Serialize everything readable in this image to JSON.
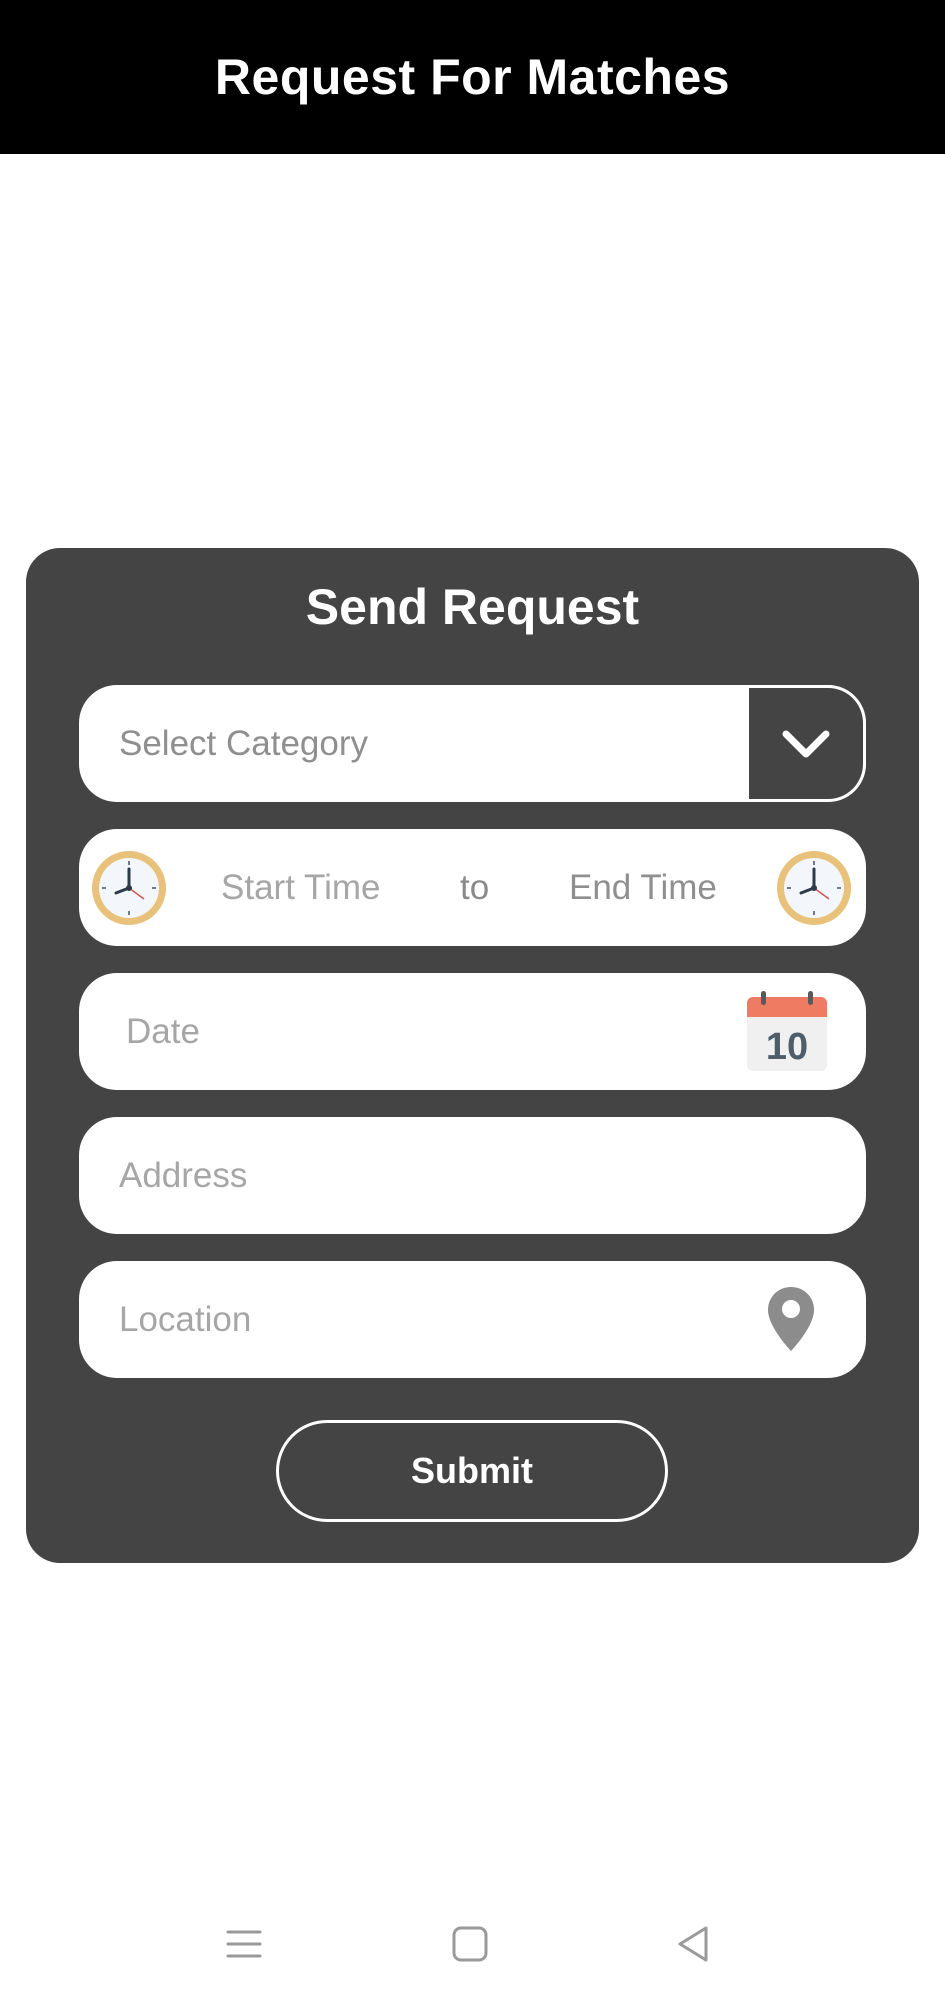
{
  "app_bar": {
    "title": "Request For Matches"
  },
  "card": {
    "title": "Send Request",
    "category": {
      "placeholder": "Select Category"
    },
    "time": {
      "start_placeholder": "Start Time",
      "separator": "to",
      "end_placeholder": "End Time"
    },
    "date": {
      "placeholder": "Date",
      "calendar_day": "10"
    },
    "address": {
      "placeholder": "Address"
    },
    "location": {
      "placeholder": "Location"
    },
    "submit_label": "Submit"
  },
  "icons": {
    "dropdown": "chevron-down-icon",
    "start_time": "clock-icon",
    "end_time": "clock-icon",
    "date": "calendar-icon",
    "location": "map-pin-icon",
    "nav_menu": "menu-icon",
    "nav_home": "home-square-icon",
    "nav_back": "back-triangle-icon"
  },
  "colors": {
    "app_bar_bg": "#000000",
    "card_bg": "#444444",
    "field_bg": "#ffffff",
    "placeholder": "#a6a6a6",
    "clock_rim": "#e8c27a",
    "calendar_header": "#f07b63"
  }
}
